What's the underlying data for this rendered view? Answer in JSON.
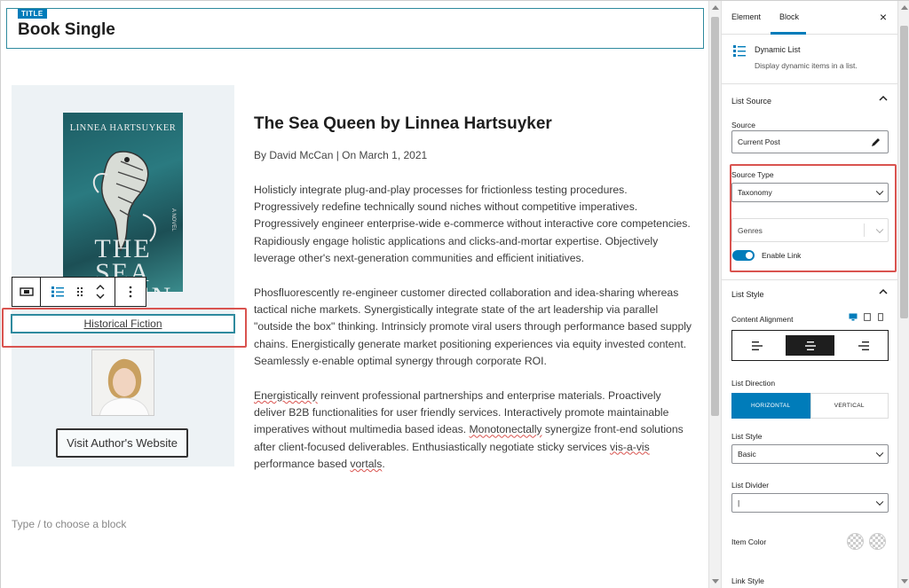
{
  "editor": {
    "title_tag": "TITLE",
    "title": "Book Single",
    "book_cover": {
      "author": "LINNEA HARTSUYKER",
      "title_line1": "THE SEA",
      "title_line2": "QUEEN",
      "novel_label": "A NOVEL"
    },
    "genre_link": "Historical Fiction",
    "author_button": "Visit Author's Website",
    "article": {
      "heading": "The Sea Queen by Linnea Hartsuyker",
      "meta": "By David McCan | On March 1, 2021",
      "para1": "Holisticly integrate plug-and-play processes for frictionless testing procedures. Progressively redefine technically sound niches without competitive imperatives. Progressively engineer enterprise-wide e-commerce without interactive core competencies. Rapidiously engage holistic applications and clicks-and-mortar expertise. Objectively leverage other's next-generation communities and efficient initiatives.",
      "para2": "Phosfluorescently re-engineer customer directed collaboration and idea-sharing whereas tactical niche markets. Synergistically integrate state of the art leadership via parallel \"outside the box\" thinking. Intrinsicly promote viral users through performance based supply chains. Energistically generate market positioning experiences via equity invested content. Seamlessly e-enable optimal synergy through corporate ROI.",
      "para3_word1": "Energistically",
      "para3_part1": " reinvent professional partnerships and enterprise materials. Proactively deliver B2B functionalities for user friendly services. Interactively promote maintainable imperatives without multimedia based ideas. ",
      "para3_word2": "Monotonectally",
      "para3_part2": " synergize front-end solutions after client-focused deliverables. Enthusiastically negotiate sticky services ",
      "para3_word3": "vis-a-vis",
      "para3_part3": " performance based ",
      "para3_word4": "vortals",
      "para3_end": "."
    },
    "placeholder": "Type / to choose a block"
  },
  "sidebar": {
    "tabs": {
      "element": "Element",
      "block": "Block"
    },
    "close": "×",
    "block_name": "Dynamic List",
    "block_desc": "Display dynamic items in a list.",
    "list_source": {
      "heading": "List Source",
      "source_label": "Source",
      "source_value": "Current Post",
      "source_type_label": "Source Type",
      "source_type_value": "Taxonomy",
      "taxonomy_value": "Genres",
      "enable_link_label": "Enable Link",
      "enable_link_on": true
    },
    "list_style_panel": {
      "heading": "List Style",
      "content_alignment_label": "Content Alignment",
      "content_alignment_selected": "center",
      "list_direction_label": "List Direction",
      "direction_horizontal": "HORIZONTAL",
      "direction_vertical": "VERTICAL",
      "list_style_label": "List Style",
      "list_style_value": "Basic",
      "list_divider_label": "List Divider",
      "list_divider_value": "|",
      "item_color_label": "Item Color",
      "link_style_label": "Link Style"
    }
  },
  "colors": {
    "accent": "#007cba",
    "highlight_red": "#d9534f",
    "block_outline": "#2e8a9e"
  }
}
